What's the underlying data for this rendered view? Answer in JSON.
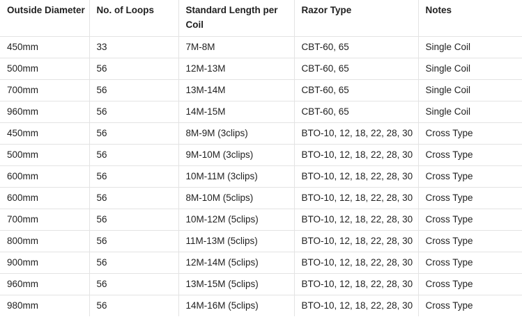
{
  "table": {
    "headers": [
      "Outside Diameter",
      "No. of Loops",
      "Standard Length per Coil",
      "Razor Type",
      "Notes"
    ],
    "rows": [
      [
        "450mm",
        "33",
        "7M-8M",
        "CBT-60, 65",
        "Single Coil"
      ],
      [
        "500mm",
        "56",
        "12M-13M",
        "CBT-60, 65",
        "Single Coil"
      ],
      [
        "700mm",
        "56",
        "13M-14M",
        "CBT-60, 65",
        "Single Coil"
      ],
      [
        "960mm",
        "56",
        "14M-15M",
        "CBT-60, 65",
        "Single Coil"
      ],
      [
        "450mm",
        "56",
        "8M-9M (3clips)",
        "BTO-10, 12, 18, 22, 28, 30",
        "Cross Type"
      ],
      [
        "500mm",
        "56",
        "9M-10M (3clips)",
        "BTO-10, 12, 18, 22, 28, 30",
        "Cross Type"
      ],
      [
        "600mm",
        "56",
        "10M-11M (3clips)",
        "BTO-10, 12, 18, 22, 28, 30",
        "Cross Type"
      ],
      [
        "600mm",
        "56",
        "8M-10M (5clips)",
        "BTO-10, 12, 18, 22, 28, 30",
        "Cross Type"
      ],
      [
        "700mm",
        "56",
        "10M-12M (5clips)",
        "BTO-10, 12, 18, 22, 28, 30",
        "Cross Type"
      ],
      [
        "800mm",
        "56",
        "11M-13M (5clips)",
        "BTO-10, 12, 18, 22, 28, 30",
        "Cross Type"
      ],
      [
        "900mm",
        "56",
        "12M-14M (5clips)",
        "BTO-10, 12, 18, 22, 28, 30",
        "Cross Type"
      ],
      [
        "960mm",
        "56",
        "13M-15M (5clips)",
        "BTO-10, 12, 18, 22, 28, 30",
        "Cross Type"
      ],
      [
        "980mm",
        "56",
        "14M-16M (5clips)",
        "BTO-10, 12, 18, 22, 28, 30",
        "Cross Type"
      ]
    ]
  }
}
